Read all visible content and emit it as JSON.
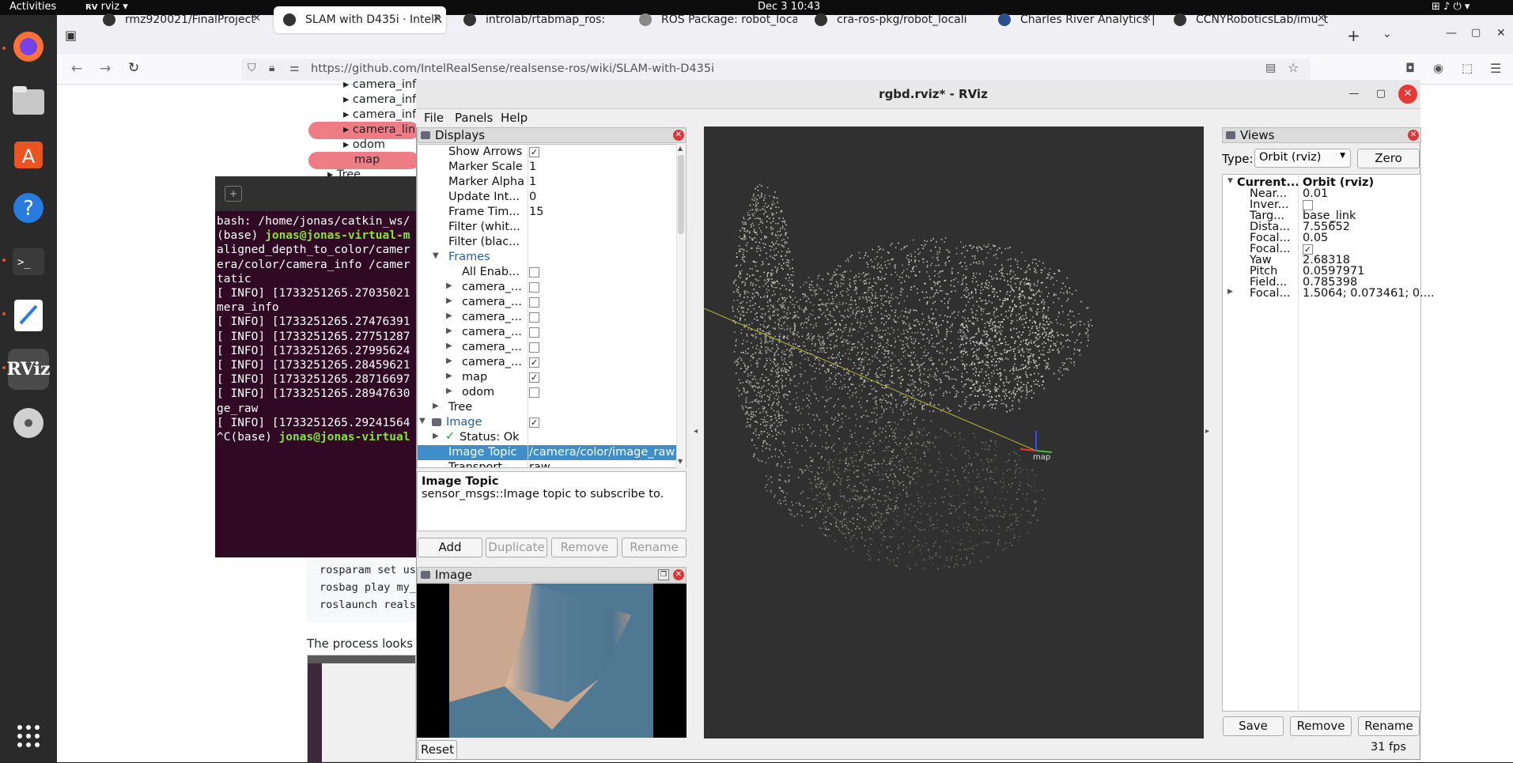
{
  "topbar": {
    "activities": "Activities",
    "app": "rviz",
    "clock": "Dec 3  10:43"
  },
  "dock": [
    "firefox-icon",
    "files-icon",
    "software-icon",
    "help-icon",
    "terminal-icon",
    "editor-icon",
    "rviz-icon",
    "dvd-icon",
    "app-grid-icon"
  ],
  "browser": {
    "tabs": [
      "rmz920021/FinalProject",
      "SLAM with D435i · IntelR",
      "introlab/rtabmap_ros: R",
      "ROS Package: robot_loca",
      "cra-ros-pkg/robot_locali",
      "Charles River Analytics |",
      "CCNYRoboticsLab/imu_t"
    ],
    "url": "https://github.com/IntelRealSense/realsense-ros/wiki/SLAM-with-D435i"
  },
  "wiki": {
    "items": [
      "camera_inf",
      "camera_inf",
      "camera_inf",
      "camera_link",
      "odom",
      "map",
      "Tree"
    ],
    "code": [
      "rosparam set us",
      "rosbag play my_",
      "roslaunch reals"
    ],
    "process_text": "The process looks l"
  },
  "terminal": {
    "lines": [
      {
        "t": "bash: /home/jonas/catkin_ws/"
      },
      {
        "t": "(base) ",
        "p": "jonas@jonas-virtual-m"
      },
      {
        "t": "aligned_depth_to_color/camer"
      },
      {
        "t": "era/color/camera_info /camer"
      },
      {
        "t": "tatic"
      },
      {
        "t": "[ INFO] [1733251265.27035021"
      },
      {
        "t": "mera_info"
      },
      {
        "t": "[ INFO] [1733251265.27476391"
      },
      {
        "t": "[ INFO] [1733251265.27751287"
      },
      {
        "t": "[ INFO] [1733251265.27995624"
      },
      {
        "t": "[ INFO] [1733251265.28459621"
      },
      {
        "t": "[ INFO] [1733251265.28716697"
      },
      {
        "t": "[ INFO] [1733251265.28947630"
      },
      {
        "t": "ge_raw"
      },
      {
        "t": "[ INFO] [1733251265.29241564"
      },
      {
        "t": "^C(base) ",
        "p": "jonas@jonas-virtual"
      }
    ]
  },
  "rviz": {
    "title": "rgbd.rviz* - RViz",
    "menu": [
      "File",
      "Panels",
      "Help"
    ],
    "displays_title": "Displays",
    "rows": [
      {
        "label": "Show Arrows",
        "indent": 1,
        "check": true
      },
      {
        "label": "Marker Scale",
        "indent": 1,
        "value": "1"
      },
      {
        "label": "Marker Alpha",
        "indent": 1,
        "value": "1"
      },
      {
        "label": "Update Int...",
        "indent": 1,
        "value": "0"
      },
      {
        "label": "Frame Tim...",
        "indent": 1,
        "value": "15"
      },
      {
        "label": "Filter (whit...",
        "indent": 1
      },
      {
        "label": "Filter (blac...",
        "indent": 1
      },
      {
        "label": "Frames",
        "indent": 1,
        "arrow": "▼",
        "blue": true
      },
      {
        "label": "All Enab...",
        "indent": 2,
        "check": false
      },
      {
        "label": "camera_...",
        "indent": 2,
        "arrow": "▶",
        "check": false
      },
      {
        "label": "camera_...",
        "indent": 2,
        "arrow": "▶",
        "check": false
      },
      {
        "label": "camera_...",
        "indent": 2,
        "arrow": "▶",
        "check": false
      },
      {
        "label": "camera_...",
        "indent": 2,
        "arrow": "▶",
        "check": false
      },
      {
        "label": "camera_...",
        "indent": 2,
        "arrow": "▶",
        "check": false
      },
      {
        "label": "camera_...",
        "indent": 2,
        "arrow": "▶",
        "check": true
      },
      {
        "label": "map",
        "indent": 2,
        "arrow": "▶",
        "check": true
      },
      {
        "label": "odom",
        "indent": 2,
        "arrow": "▶",
        "check": false
      },
      {
        "label": "Tree",
        "indent": 1,
        "arrow": "▶"
      },
      {
        "label": "Image",
        "indent": 0,
        "arrow": "▼",
        "check": true,
        "blue": true,
        "icon": true
      },
      {
        "label": "Status: Ok",
        "indent": 1,
        "arrow": "▶",
        "ok": true
      },
      {
        "label": "Image Topic",
        "indent": 1,
        "value": "/camera/color/image_raw",
        "selected": true
      },
      {
        "label": "Transport ...",
        "indent": 1,
        "value": "raw"
      }
    ],
    "desc_title": "Image Topic",
    "desc_text": "sensor_msgs::Image topic to subscribe to.",
    "buttons": {
      "add": "Add",
      "duplicate": "Duplicate",
      "remove": "Remove",
      "rename": "Rename"
    },
    "image_panel_title": "Image",
    "reset": "Reset",
    "views": {
      "title": "Views",
      "type_label": "Type:",
      "type_value": "Orbit (rviz)",
      "zero": "Zero",
      "rows": [
        {
          "k": "Current...",
          "v": "Orbit (rviz)",
          "bold": true,
          "arrow": "▼"
        },
        {
          "k": "Near...",
          "v": "0.01"
        },
        {
          "k": "Inver...",
          "check": false
        },
        {
          "k": "Targ...",
          "v": "base_link"
        },
        {
          "k": "Dista...",
          "v": "7.55652"
        },
        {
          "k": "Focal...",
          "v": "0.05"
        },
        {
          "k": "Focal...",
          "check": true
        },
        {
          "k": "Yaw",
          "v": "2.68318"
        },
        {
          "k": "Pitch",
          "v": "0.0597971"
        },
        {
          "k": "Field...",
          "v": "0.785398"
        },
        {
          "k": "Focal...",
          "v": "1.5064; 0.073461; 0....",
          "arrow": "▶"
        }
      ],
      "save": "Save",
      "remove": "Remove",
      "rename": "Rename"
    },
    "map_label": "map",
    "fps": "31 fps"
  }
}
